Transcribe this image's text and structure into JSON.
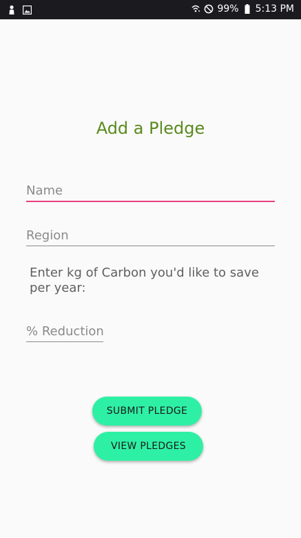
{
  "status_bar": {
    "battery": "99%",
    "time": "5:13 PM",
    "icons": [
      "notification-person-icon",
      "gallery-icon",
      "wifi-icon",
      "do-not-disturb-icon",
      "battery-icon"
    ]
  },
  "page": {
    "title": "Add a Pledge"
  },
  "form": {
    "name_placeholder": "Name",
    "region_placeholder": "Region",
    "prompt": "Enter kg of Carbon you'd like to save per year:",
    "reduction_placeholder": "% Reduction"
  },
  "buttons": {
    "submit_label": "SUBMIT PLEDGE",
    "view_label": "VIEW PLEDGES"
  },
  "colors": {
    "title": "#5a8a1e",
    "focus_underline": "#e8407c",
    "button": "#2ef0a4",
    "status_bar": "#1b1b1f"
  }
}
